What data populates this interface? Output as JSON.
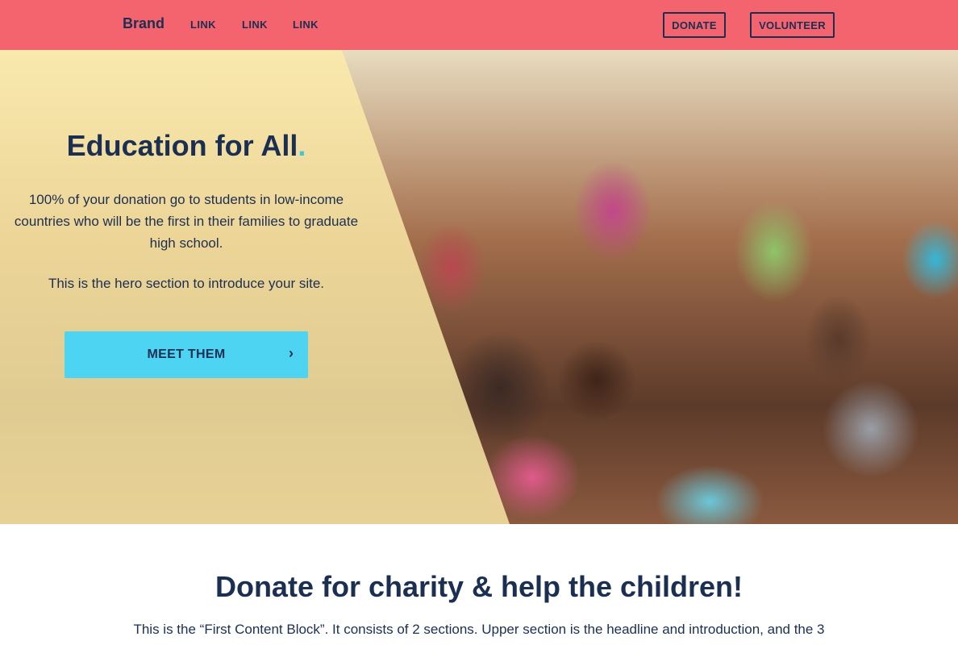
{
  "navbar": {
    "brand": "Brand",
    "links": [
      "LINK",
      "LINK",
      "LINK"
    ],
    "donate_label": "DONATE",
    "volunteer_label": "VOLUNTEER",
    "background_color": "#f3646f"
  },
  "hero": {
    "title": "Education for All",
    "title_dot": ".",
    "description": "100% of your donation go to students in low-income countries who will be the first in their families to graduate high school.",
    "subtitle": "This is the hero section to introduce your site.",
    "cta_label": "MEET THEM",
    "cta_arrow": "›",
    "cta_color": "#4dd4f3",
    "overlay_color": "#fdeca8"
  },
  "content": {
    "title": "Donate for charity & help the children!",
    "intro": "This is the “First Content Block”. It consists of 2 sections. Upper section is the headline and introduction, and the 3"
  },
  "colors": {
    "primary_text": "#1b2f52",
    "accent": "#43c6d8"
  }
}
